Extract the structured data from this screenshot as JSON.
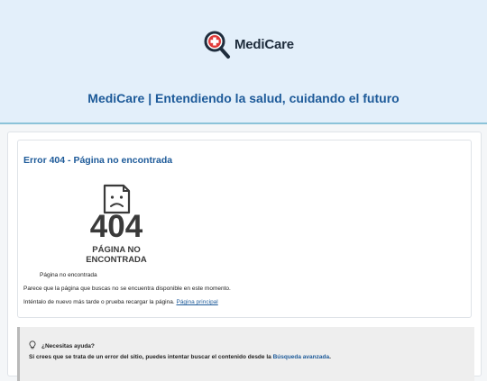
{
  "header": {
    "logo_text": "MediCare",
    "logo_icon": "magnifier-cross-icon",
    "tagline": "MediCare | Entendiendo la salud, cuidando el futuro"
  },
  "error": {
    "title": "Error 404 - Página no encontrada",
    "illustration": {
      "icon": "sad-document-icon",
      "code": "404",
      "caption_line1": "PÁGINA NO",
      "caption_line2": "ENCONTRADA"
    },
    "image_caption": "Página no encontrada",
    "message": "Parece que la página que buscas no se encuentra disponible en este momento.",
    "retry_text": "Inténtalo de nuevo más tarde o prueba recargar la página.",
    "home_link": "Página principal"
  },
  "help": {
    "icon": "lightbulb-icon",
    "title": "¿Necesitas ayuda?",
    "text": "Si crees que se trata de un error del sitio, puedes intentar buscar el contenido desde la",
    "link": "Búsqueda avanzada",
    "suffix": "."
  },
  "colors": {
    "brand_blue": "#1d5a99",
    "header_bg": "#e3effa",
    "logo_red": "#e03a3a"
  }
}
